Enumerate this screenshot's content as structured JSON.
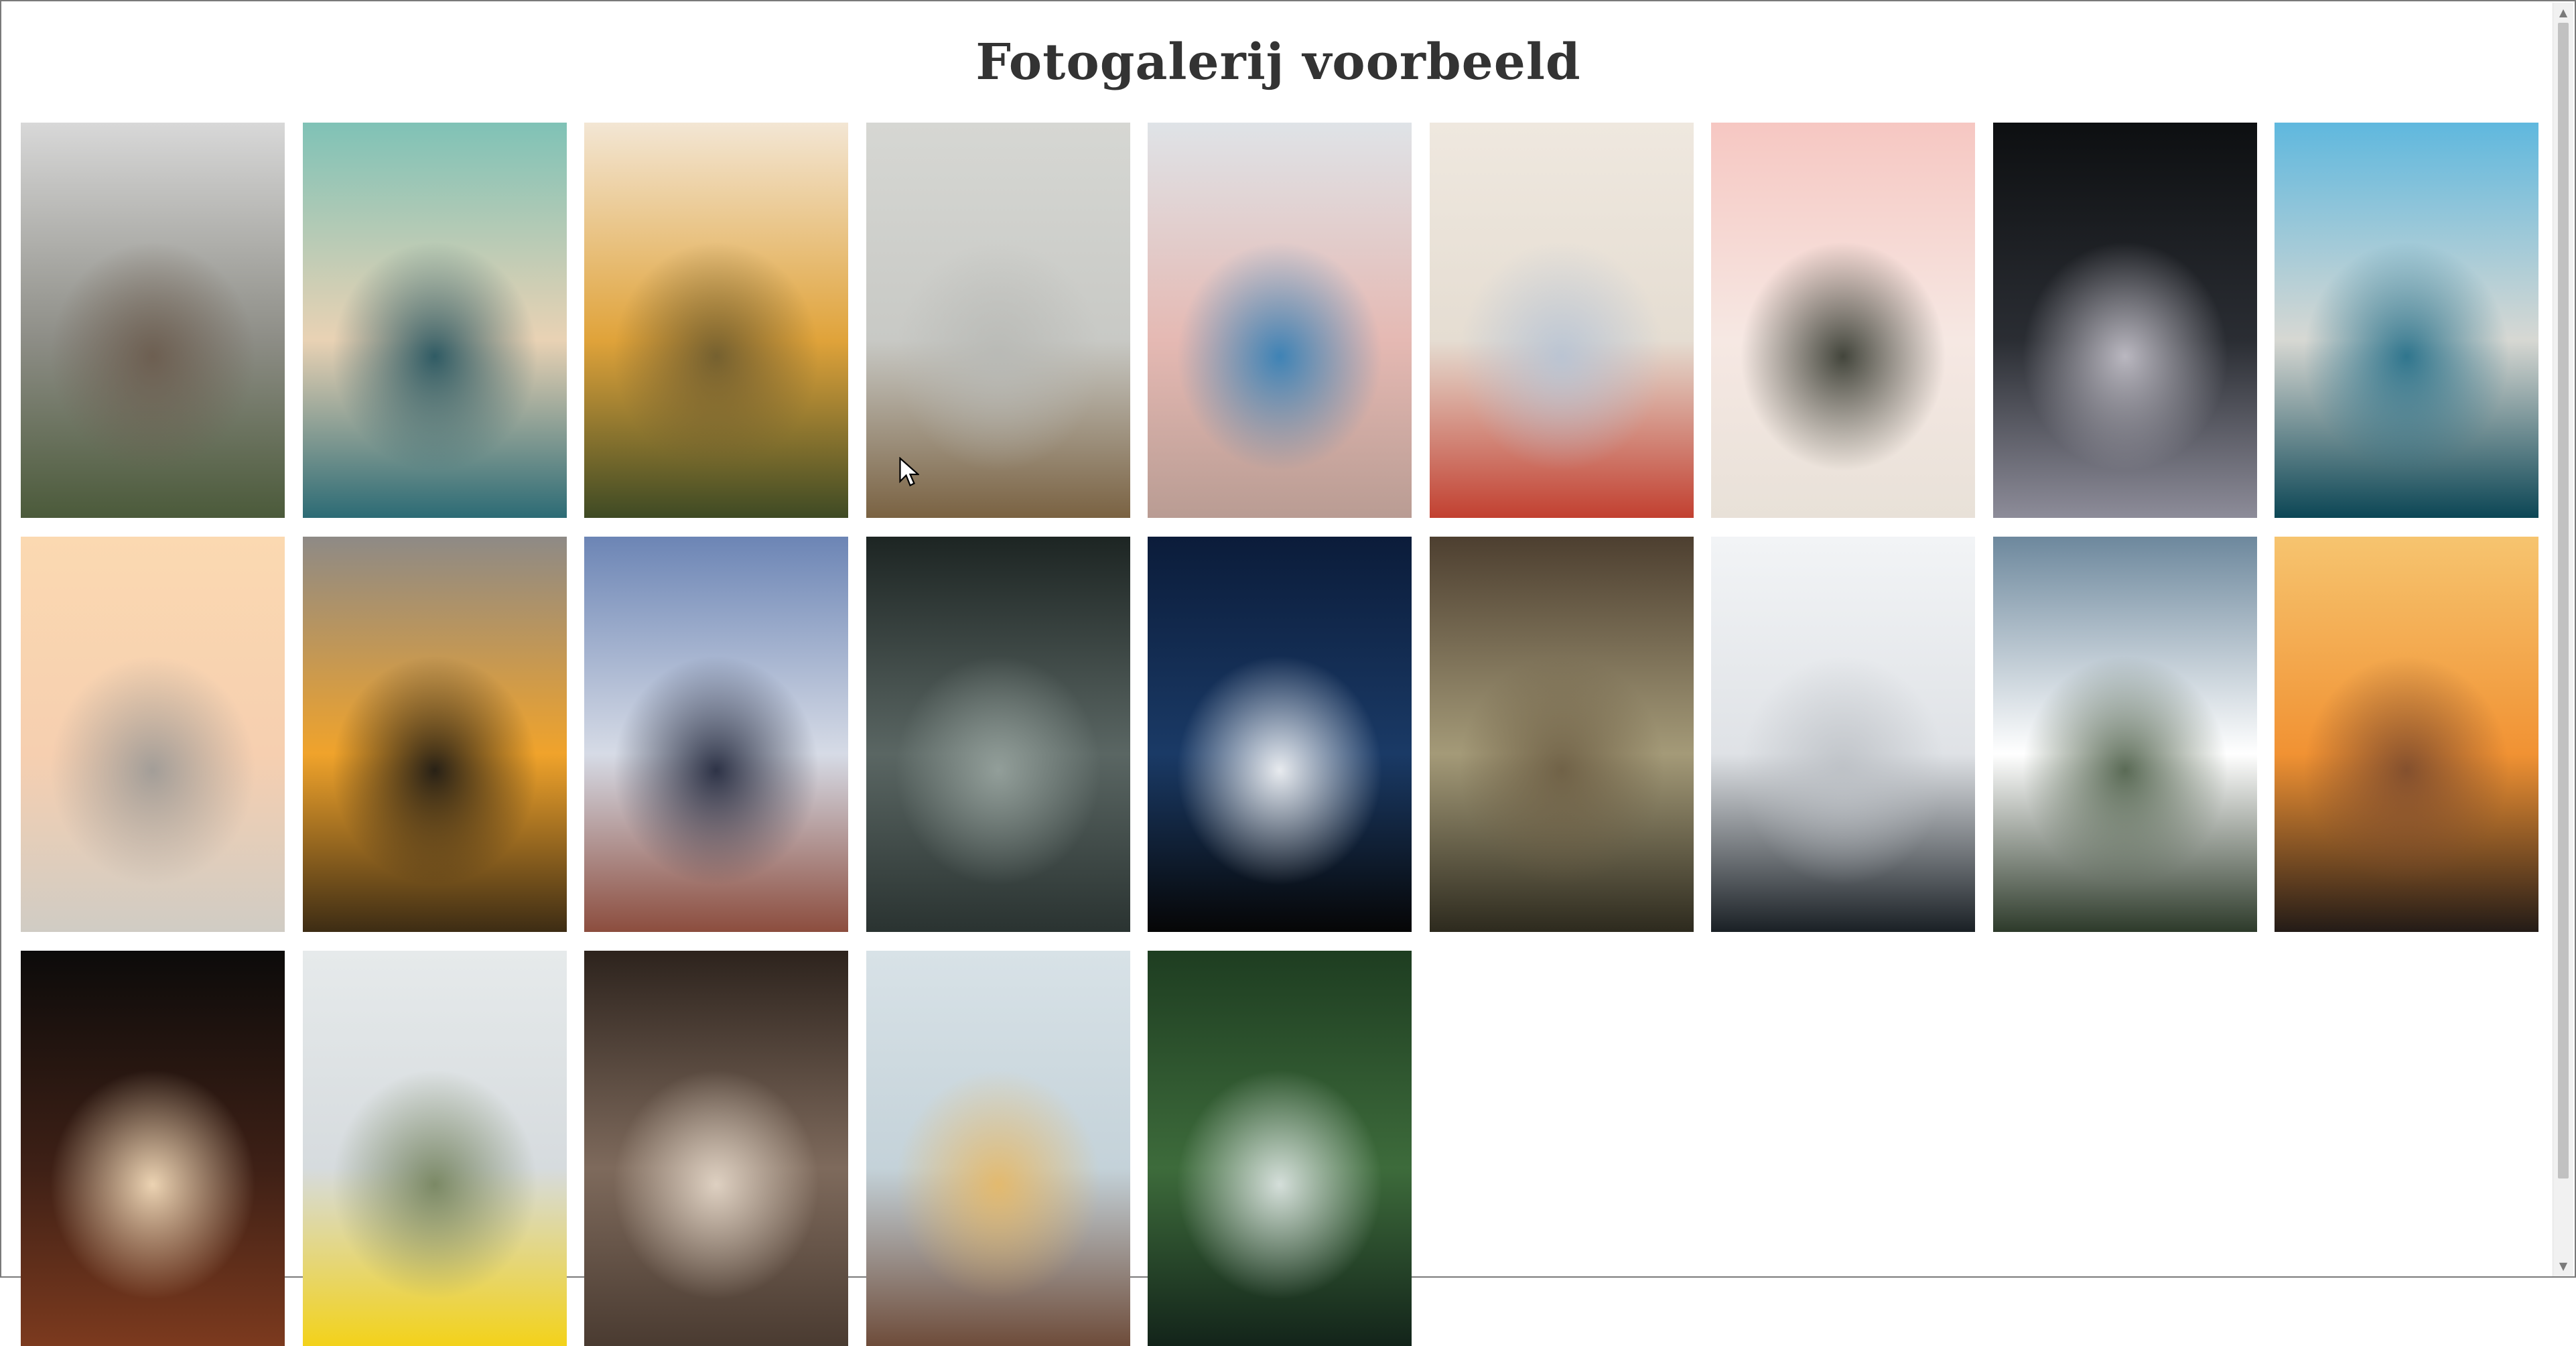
{
  "page": {
    "title": "Fotogalerij voorbeeld"
  },
  "gallery": {
    "photos": [
      {
        "name": "photo-cliff-house",
        "palette": [
          "#d8d8d8",
          "#8d8d86",
          "#6a5a4c",
          "#4b5a3a"
        ]
      },
      {
        "name": "photo-sailing-ship",
        "palette": [
          "#7fc2b6",
          "#e9d2b4",
          "#1d4f5c",
          "#2c6b75"
        ]
      },
      {
        "name": "photo-yellow-flowers",
        "palette": [
          "#f3e6d4",
          "#e0a33a",
          "#6b5a2f",
          "#3e4a24"
        ]
      },
      {
        "name": "photo-pine-cones-plate",
        "palette": [
          "#d6d7d3",
          "#c8c9c5",
          "#b8b9b5",
          "#7a6242"
        ]
      },
      {
        "name": "photo-breakdancer-street",
        "palette": [
          "#dfe3e7",
          "#e5b9b3",
          "#2c7db6",
          "#b99c93"
        ]
      },
      {
        "name": "photo-apples-net-bag",
        "palette": [
          "#efe8df",
          "#e5ddd2",
          "#b6c3d4",
          "#c24030"
        ]
      },
      {
        "name": "photo-woman-dalmatian",
        "palette": [
          "#f6c7c2",
          "#f6e8e3",
          "#2f3329",
          "#e8e1d8"
        ]
      },
      {
        "name": "photo-dark-wave",
        "palette": [
          "#0d0f11",
          "#2a2d33",
          "#c9c6cf",
          "#8d8c99"
        ]
      },
      {
        "name": "photo-louvre-pyramid",
        "palette": [
          "#5fb8de",
          "#d7d8d3",
          "#1f6c87",
          "#0c4655"
        ]
      },
      {
        "name": "photo-white-spire",
        "palette": [
          "#fbd9b1",
          "#f6cfb0",
          "#9a9895",
          "#d0ccc4"
        ]
      },
      {
        "name": "photo-city-skyline-sunset",
        "palette": [
          "#8e8a86",
          "#f0a32b",
          "#141414",
          "#3d2c14"
        ]
      },
      {
        "name": "photo-golden-gate-waves",
        "palette": [
          "#6c85b5",
          "#d6dbe6",
          "#1c2237",
          "#8c4d3e"
        ]
      },
      {
        "name": "photo-rainy-window-city",
        "palette": [
          "#1d2523",
          "#5a6663",
          "#99a5a0",
          "#2a3331"
        ]
      },
      {
        "name": "photo-lighthouse-night",
        "palette": [
          "#0b1c3a",
          "#1a3a66",
          "#ffffff",
          "#060606"
        ]
      },
      {
        "name": "photo-tree-tunnel",
        "palette": [
          "#4d3f30",
          "#a49a78",
          "#6c5d43",
          "#2d2a1e"
        ]
      },
      {
        "name": "photo-white-building-corner",
        "palette": [
          "#f2f4f6",
          "#dfe2e6",
          "#bcc0c5",
          "#1a2025"
        ]
      },
      {
        "name": "photo-misty-mountain-forest",
        "palette": [
          "#6d889d",
          "#ffffff",
          "#4a5c45",
          "#2d3a2a"
        ]
      },
      {
        "name": "photo-orange-sunset-hills",
        "palette": [
          "#f6c46f",
          "#f19233",
          "#7a4a2e",
          "#231b17"
        ]
      },
      {
        "name": "photo-cave-light",
        "palette": [
          "#0c0b0a",
          "#3e2016",
          "#ffe7c4",
          "#7c3a1e"
        ]
      },
      {
        "name": "photo-yellow-coat-hiker",
        "palette": [
          "#e6eaeb",
          "#d6dbde",
          "#71805a",
          "#f3d21a"
        ]
      },
      {
        "name": "photo-gothic-arches",
        "palette": [
          "#2d231d",
          "#7e6a5c",
          "#e9dccd",
          "#4a3b31"
        ]
      },
      {
        "name": "photo-hot-air-balloon",
        "palette": [
          "#d8e2e7",
          "#c4d2d9",
          "#e7b864",
          "#6e4c3a"
        ]
      },
      {
        "name": "photo-jungle-waterfall",
        "palette": [
          "#1e3d21",
          "#3d6b3b",
          "#e6ecec",
          "#13241a"
        ]
      }
    ]
  }
}
